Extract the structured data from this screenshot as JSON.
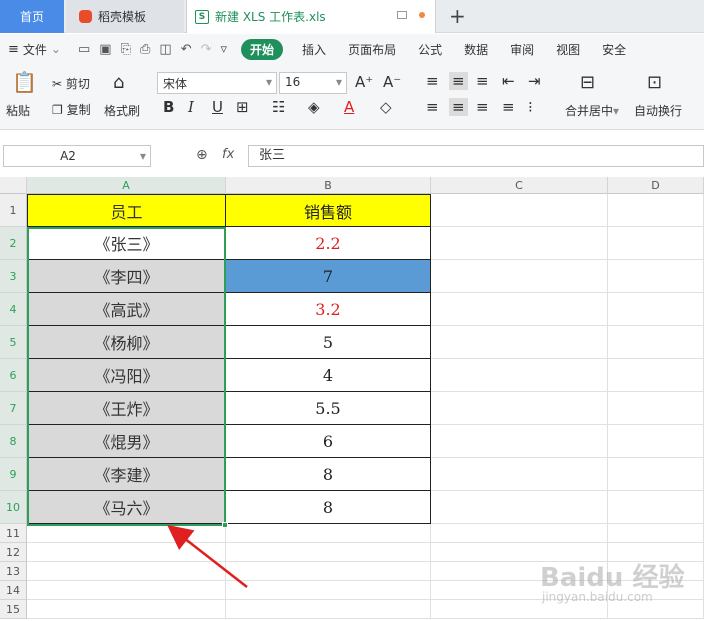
{
  "tabs": {
    "home": "首页",
    "template": "稻壳模板",
    "file": "新建 XLS 工作表.xls"
  },
  "menu": {
    "file": "文件",
    "items": [
      "开始",
      "插入",
      "页面布局",
      "公式",
      "数据",
      "审阅",
      "视图",
      "安全"
    ]
  },
  "ribbon": {
    "paste": "粘贴",
    "cut": "剪切",
    "copy": "复制",
    "format_painter": "格式刷",
    "font_name": "宋体",
    "font_size": "16",
    "merge_center": "合并居中",
    "auto_wrap": "自动换行"
  },
  "formula_bar": {
    "cell_ref": "A2",
    "fx": "fx",
    "content": "张三"
  },
  "columns": [
    "A",
    "B",
    "C",
    "D"
  ],
  "rows": [
    {
      "n": "1",
      "a": "员工",
      "b": "销售额",
      "header": true
    },
    {
      "n": "2",
      "a": "《张三》",
      "b": "2.2",
      "red": true
    },
    {
      "n": "3",
      "a": "《李四》",
      "b": "7",
      "blue": true
    },
    {
      "n": "4",
      "a": "《高武》",
      "b": "3.2",
      "red": true
    },
    {
      "n": "5",
      "a": "《杨柳》",
      "b": "5"
    },
    {
      "n": "6",
      "a": "《冯阳》",
      "b": "4"
    },
    {
      "n": "7",
      "a": "《王炸》",
      "b": "5.5"
    },
    {
      "n": "8",
      "a": "《焜男》",
      "b": "6"
    },
    {
      "n": "9",
      "a": "《李建》",
      "b": "8"
    },
    {
      "n": "10",
      "a": "《马六》",
      "b": "8"
    }
  ],
  "empty_rows": [
    "11",
    "12",
    "13",
    "14",
    "15"
  ],
  "watermark": {
    "main": "Baidu 经验",
    "sub": "jingyan.baidu.com"
  },
  "colors": {
    "header_fill": "#ffff00",
    "selected_fill": "#d9d9d9",
    "highlight_fill": "#5b9bd5",
    "red_text": "#e02020",
    "accent": "#1f8f5b"
  }
}
